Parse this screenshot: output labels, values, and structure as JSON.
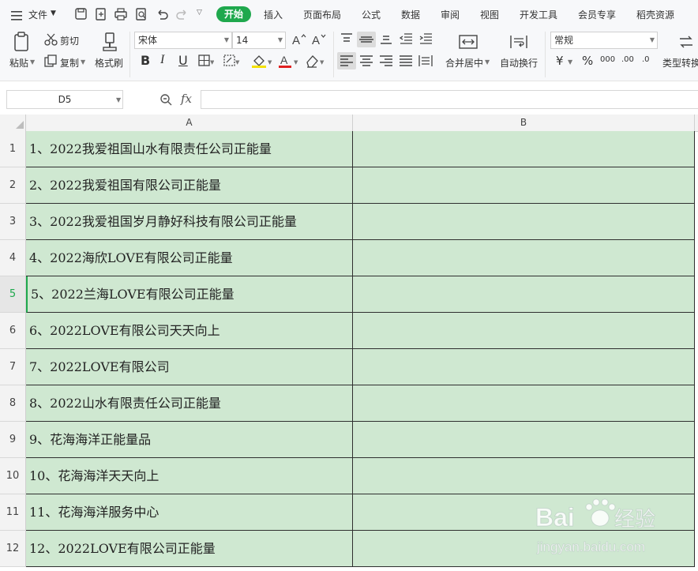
{
  "menubar": {
    "file_label": "文件",
    "tabs": [
      "开始",
      "插入",
      "页面布局",
      "公式",
      "数据",
      "审阅",
      "视图",
      "开发工具",
      "会员专享",
      "稻壳资源"
    ]
  },
  "ribbon": {
    "paste_label": "粘贴",
    "cut_label": "剪切",
    "copy_label": "复制",
    "format_painter_label": "格式刷",
    "font_name": "宋体",
    "font_size": "14",
    "bold_glyph": "B",
    "italic_glyph": "I",
    "underline_glyph": "U",
    "merge_center_label": "合并居中",
    "wrap_text_label": "自动换行",
    "number_format": "常规",
    "currency_glyph": "¥",
    "percent_glyph": "%",
    "thousands_glyph": "000",
    "decimal_inc_glyph": ".00",
    "decimal_dec_glyph": ".0",
    "type_convert_label": "类型转换"
  },
  "formula_bar": {
    "name_box": "D5",
    "fx_label": "fx",
    "value": ""
  },
  "sheet": {
    "columns": [
      "A",
      "B"
    ],
    "active_row": 5,
    "rows": [
      {
        "num": "1",
        "a": "1、2022我爱祖国山水有限责任公司正能量",
        "b": ""
      },
      {
        "num": "2",
        "a": "2、2022我爱祖国有限公司正能量",
        "b": ""
      },
      {
        "num": "3",
        "a": "3、2022我爱祖国岁月静好科技有限公司正能量",
        "b": ""
      },
      {
        "num": "4",
        "a": "4、2022海欣LOVE有限公司正能量",
        "b": ""
      },
      {
        "num": "5",
        "a": "5、2022兰海LOVE有限公司正能量",
        "b": ""
      },
      {
        "num": "6",
        "a": "6、2022LOVE有限公司天天向上",
        "b": ""
      },
      {
        "num": "7",
        "a": "7、2022LOVE有限公司",
        "b": ""
      },
      {
        "num": "8",
        "a": "8、2022山水有限责任公司正能量",
        "b": ""
      },
      {
        "num": "9",
        "a": "9、花海海洋正能量品",
        "b": ""
      },
      {
        "num": "10",
        "a": "10、花海海洋天天向上",
        "b": ""
      },
      {
        "num": "11",
        "a": "11、花海海洋服务中心",
        "b": ""
      },
      {
        "num": "12",
        "a": "12、2022LOVE有限公司正能量",
        "b": ""
      }
    ]
  },
  "watermark": {
    "brand": "Bai",
    "brand_suffix": "经验",
    "url": "jingyan.baidu.com"
  },
  "colors": {
    "accent": "#1fa84d",
    "cell_fill": "#cfe8d1"
  }
}
